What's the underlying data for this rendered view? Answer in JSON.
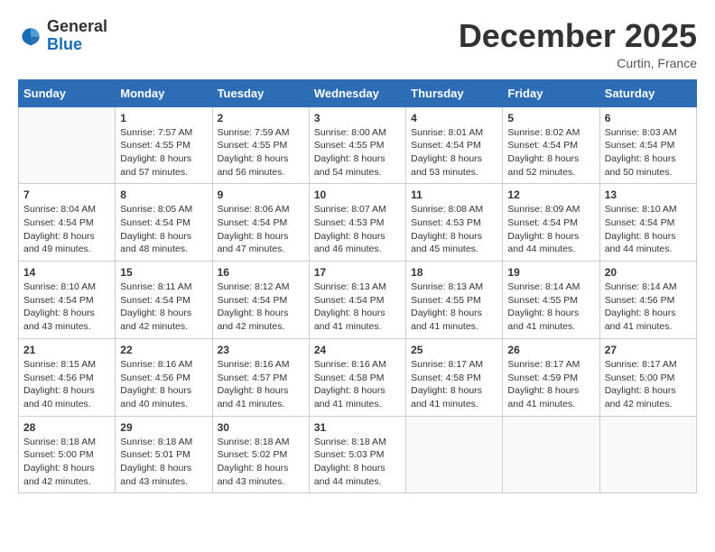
{
  "header": {
    "logo_general": "General",
    "logo_blue": "Blue",
    "month_title": "December 2025",
    "location": "Curtin, France"
  },
  "weekdays": [
    "Sunday",
    "Monday",
    "Tuesday",
    "Wednesday",
    "Thursday",
    "Friday",
    "Saturday"
  ],
  "weeks": [
    [
      {
        "day": "",
        "empty": true
      },
      {
        "day": "1",
        "sunrise": "7:57 AM",
        "sunset": "4:55 PM",
        "daylight": "8 hours and 57 minutes."
      },
      {
        "day": "2",
        "sunrise": "7:59 AM",
        "sunset": "4:55 PM",
        "daylight": "8 hours and 56 minutes."
      },
      {
        "day": "3",
        "sunrise": "8:00 AM",
        "sunset": "4:55 PM",
        "daylight": "8 hours and 54 minutes."
      },
      {
        "day": "4",
        "sunrise": "8:01 AM",
        "sunset": "4:54 PM",
        "daylight": "8 hours and 53 minutes."
      },
      {
        "day": "5",
        "sunrise": "8:02 AM",
        "sunset": "4:54 PM",
        "daylight": "8 hours and 52 minutes."
      },
      {
        "day": "6",
        "sunrise": "8:03 AM",
        "sunset": "4:54 PM",
        "daylight": "8 hours and 50 minutes."
      }
    ],
    [
      {
        "day": "7",
        "sunrise": "8:04 AM",
        "sunset": "4:54 PM",
        "daylight": "8 hours and 49 minutes."
      },
      {
        "day": "8",
        "sunrise": "8:05 AM",
        "sunset": "4:54 PM",
        "daylight": "8 hours and 48 minutes."
      },
      {
        "day": "9",
        "sunrise": "8:06 AM",
        "sunset": "4:54 PM",
        "daylight": "8 hours and 47 minutes."
      },
      {
        "day": "10",
        "sunrise": "8:07 AM",
        "sunset": "4:53 PM",
        "daylight": "8 hours and 46 minutes."
      },
      {
        "day": "11",
        "sunrise": "8:08 AM",
        "sunset": "4:53 PM",
        "daylight": "8 hours and 45 minutes."
      },
      {
        "day": "12",
        "sunrise": "8:09 AM",
        "sunset": "4:54 PM",
        "daylight": "8 hours and 44 minutes."
      },
      {
        "day": "13",
        "sunrise": "8:10 AM",
        "sunset": "4:54 PM",
        "daylight": "8 hours and 44 minutes."
      }
    ],
    [
      {
        "day": "14",
        "sunrise": "8:10 AM",
        "sunset": "4:54 PM",
        "daylight": "8 hours and 43 minutes."
      },
      {
        "day": "15",
        "sunrise": "8:11 AM",
        "sunset": "4:54 PM",
        "daylight": "8 hours and 42 minutes."
      },
      {
        "day": "16",
        "sunrise": "8:12 AM",
        "sunset": "4:54 PM",
        "daylight": "8 hours and 42 minutes."
      },
      {
        "day": "17",
        "sunrise": "8:13 AM",
        "sunset": "4:54 PM",
        "daylight": "8 hours and 41 minutes."
      },
      {
        "day": "18",
        "sunrise": "8:13 AM",
        "sunset": "4:55 PM",
        "daylight": "8 hours and 41 minutes."
      },
      {
        "day": "19",
        "sunrise": "8:14 AM",
        "sunset": "4:55 PM",
        "daylight": "8 hours and 41 minutes."
      },
      {
        "day": "20",
        "sunrise": "8:14 AM",
        "sunset": "4:56 PM",
        "daylight": "8 hours and 41 minutes."
      }
    ],
    [
      {
        "day": "21",
        "sunrise": "8:15 AM",
        "sunset": "4:56 PM",
        "daylight": "8 hours and 40 minutes."
      },
      {
        "day": "22",
        "sunrise": "8:16 AM",
        "sunset": "4:56 PM",
        "daylight": "8 hours and 40 minutes."
      },
      {
        "day": "23",
        "sunrise": "8:16 AM",
        "sunset": "4:57 PM",
        "daylight": "8 hours and 41 minutes."
      },
      {
        "day": "24",
        "sunrise": "8:16 AM",
        "sunset": "4:58 PM",
        "daylight": "8 hours and 41 minutes."
      },
      {
        "day": "25",
        "sunrise": "8:17 AM",
        "sunset": "4:58 PM",
        "daylight": "8 hours and 41 minutes."
      },
      {
        "day": "26",
        "sunrise": "8:17 AM",
        "sunset": "4:59 PM",
        "daylight": "8 hours and 41 minutes."
      },
      {
        "day": "27",
        "sunrise": "8:17 AM",
        "sunset": "5:00 PM",
        "daylight": "8 hours and 42 minutes."
      }
    ],
    [
      {
        "day": "28",
        "sunrise": "8:18 AM",
        "sunset": "5:00 PM",
        "daylight": "8 hours and 42 minutes."
      },
      {
        "day": "29",
        "sunrise": "8:18 AM",
        "sunset": "5:01 PM",
        "daylight": "8 hours and 43 minutes."
      },
      {
        "day": "30",
        "sunrise": "8:18 AM",
        "sunset": "5:02 PM",
        "daylight": "8 hours and 43 minutes."
      },
      {
        "day": "31",
        "sunrise": "8:18 AM",
        "sunset": "5:03 PM",
        "daylight": "8 hours and 44 minutes."
      },
      {
        "day": "",
        "empty": true
      },
      {
        "day": "",
        "empty": true
      },
      {
        "day": "",
        "empty": true
      }
    ]
  ],
  "labels": {
    "sunrise": "Sunrise:",
    "sunset": "Sunset:",
    "daylight": "Daylight:"
  }
}
